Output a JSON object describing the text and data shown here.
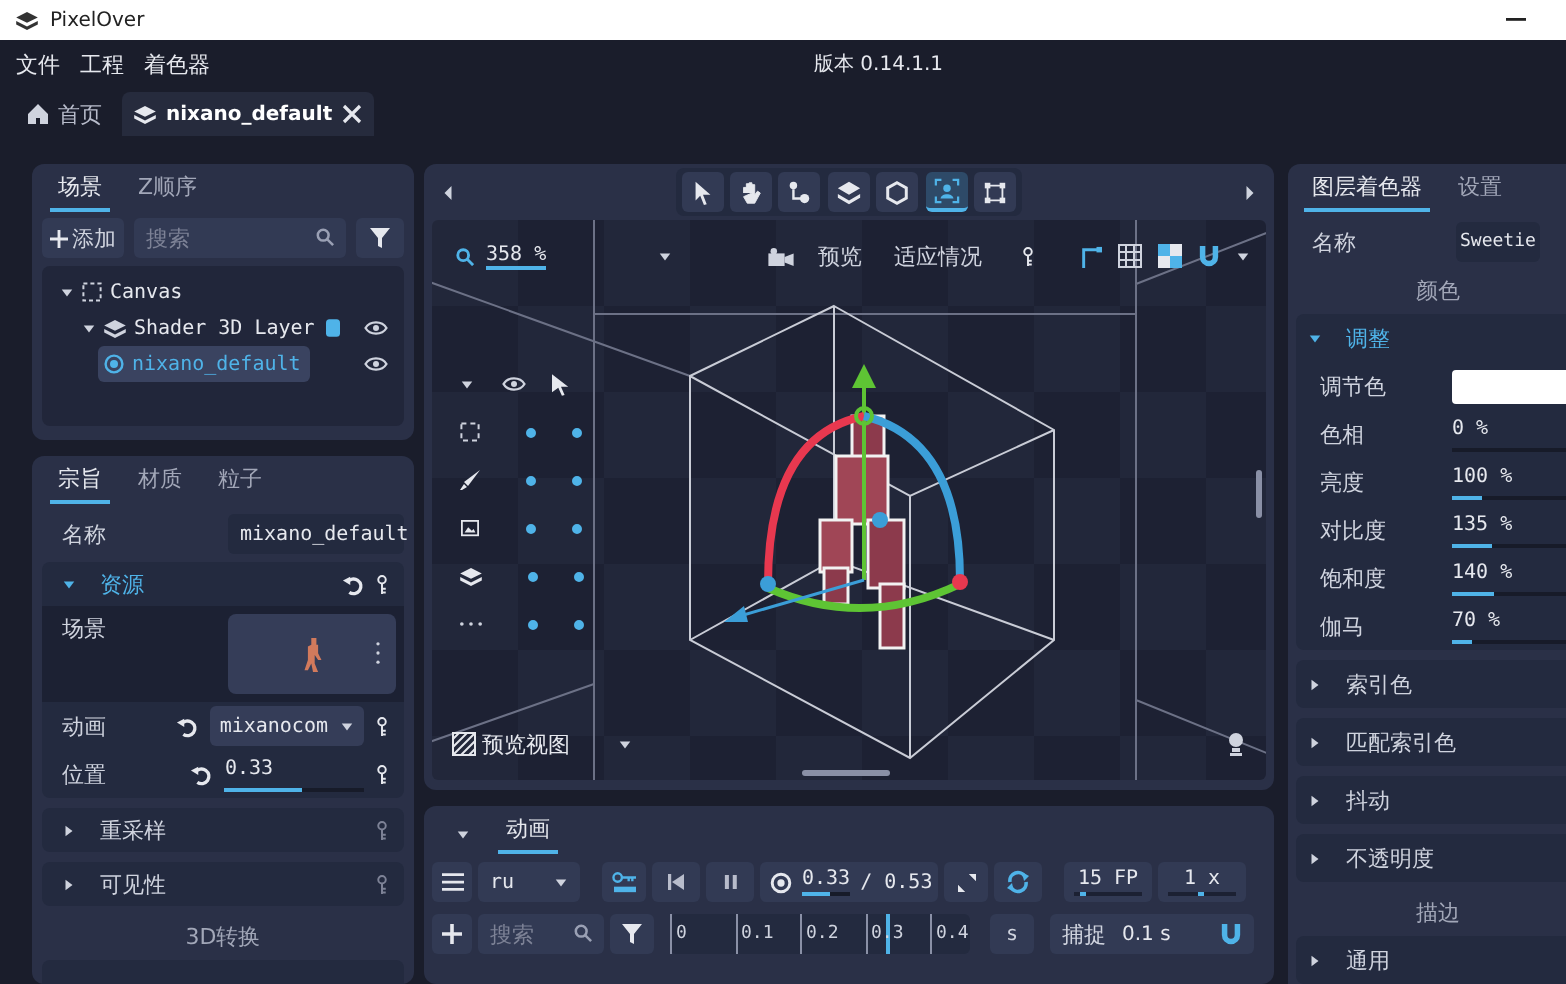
{
  "window": {
    "title": "PixelOver"
  },
  "menu": [
    {
      "label": "文件"
    },
    {
      "label": "工程"
    },
    {
      "label": "着色器"
    }
  ],
  "version": "版本 0.14.1.1",
  "doc_tabs": [
    {
      "kind": "home",
      "label": "首页",
      "selected": false
    },
    {
      "kind": "scene",
      "label": "nixano_default",
      "selected": true
    }
  ],
  "scene_panel": {
    "tabs": [
      {
        "label": "场景",
        "selected": true
      },
      {
        "label": "Z顺序",
        "selected": false
      }
    ],
    "add_button": "添加",
    "search": {
      "placeholder": "搜索"
    },
    "tree": [
      {
        "kind": "canvas",
        "label": "Canvas",
        "expanded": true,
        "selected": false,
        "children": [
          {
            "kind": "layer",
            "label": "Shader 3D Layer",
            "expanded": true,
            "selected": false,
            "visible": true,
            "children": [
              {
                "kind": "model",
                "label": "nixano_default",
                "selected": true,
                "visible": true
              }
            ]
          }
        ]
      }
    ]
  },
  "properties_panel": {
    "tabs": [
      {
        "label": "宗旨",
        "selected": true
      },
      {
        "label": "材质",
        "selected": false
      },
      {
        "label": "粒子",
        "selected": false
      }
    ],
    "name": {
      "label": "名称",
      "value": "mixano_default"
    },
    "sections": [
      {
        "title": "资源",
        "expanded": true,
        "rows": [
          {
            "kind": "scene",
            "label": "场景"
          },
          {
            "kind": "dropdown",
            "label": "动画",
            "value": "mixanocom"
          },
          {
            "kind": "slider",
            "label": "位置",
            "value": "0.33",
            "level": 0.55
          }
        ]
      },
      {
        "title": "重采样",
        "expanded": false
      },
      {
        "title": "可见性",
        "expanded": false
      }
    ],
    "heading": "3D转换"
  },
  "viewport": {
    "tool_groups": [
      [
        {
          "kind": "select",
          "selected": false
        },
        {
          "kind": "pan",
          "selected": false
        },
        {
          "kind": "bone",
          "selected": false
        }
      ],
      [
        {
          "kind": "layers",
          "selected": false
        },
        {
          "kind": "shape",
          "selected": false
        }
      ],
      [
        {
          "kind": "camera",
          "selected": true
        },
        {
          "kind": "crop",
          "selected": false
        }
      ]
    ],
    "zoom": "358 %",
    "preview": "预览",
    "fit": "适应情况",
    "layer_filters": [
      {
        "kind": "canvas",
        "visible": true,
        "selectable": true
      },
      {
        "kind": "brush",
        "visible": true,
        "selectable": true
      },
      {
        "kind": "image",
        "visible": true,
        "selectable": true
      },
      {
        "kind": "layers",
        "visible": true,
        "selectable": true
      },
      {
        "kind": "more",
        "visible": true,
        "selectable": true
      }
    ],
    "view_button": "预览视图"
  },
  "animation_panel": {
    "tabs": [
      {
        "label": "动画",
        "selected": true
      }
    ],
    "track": "ru",
    "time": {
      "value": "0.33",
      "level": 0.6
    },
    "total": "/ 0.53",
    "loop": true,
    "fps": {
      "value": "15 FP",
      "level": 0.08
    },
    "speed": {
      "value": "1 x",
      "level": 0.45
    },
    "search": {
      "placeholder": "搜索"
    },
    "ticks": [
      "0",
      "0.1",
      "0.2",
      "0.3",
      "0.4"
    ],
    "playhead": {
      "level": 0.72
    },
    "unit": "s",
    "snap": {
      "label": "捕捉",
      "value": "0.1 s",
      "on": true
    }
  },
  "shader_panel": {
    "tabs": [
      {
        "label": "图层着色器",
        "selected": true
      },
      {
        "label": "设置",
        "selected": false
      }
    ],
    "name": {
      "label": "名称",
      "value": "Sweetie"
    },
    "heading": "颜色",
    "sections": [
      {
        "title": "调整",
        "expanded": true,
        "rows": [
          {
            "kind": "color",
            "label": "调节色",
            "color": "#ffffff"
          },
          {
            "kind": "slider",
            "label": "色相",
            "value": "0 %",
            "level": 0
          },
          {
            "kind": "slider",
            "label": "亮度",
            "value": "100 %",
            "level": 0.25
          },
          {
            "kind": "slider",
            "label": "对比度",
            "value": "135 %",
            "level": 0.34
          },
          {
            "kind": "slider",
            "label": "饱和度",
            "value": "140 %",
            "level": 0.35
          },
          {
            "kind": "slider",
            "label": "伽马",
            "value": "70 %",
            "level": 0.17
          }
        ]
      },
      {
        "title": "索引色",
        "expanded": false
      },
      {
        "title": "匹配索引色",
        "expanded": false
      },
      {
        "title": "抖动",
        "expanded": false
      },
      {
        "title": "不透明度",
        "expanded": false
      }
    ],
    "heading_2": "描边",
    "sections_2": [
      {
        "title": "通用",
        "expanded": false
      }
    ]
  }
}
